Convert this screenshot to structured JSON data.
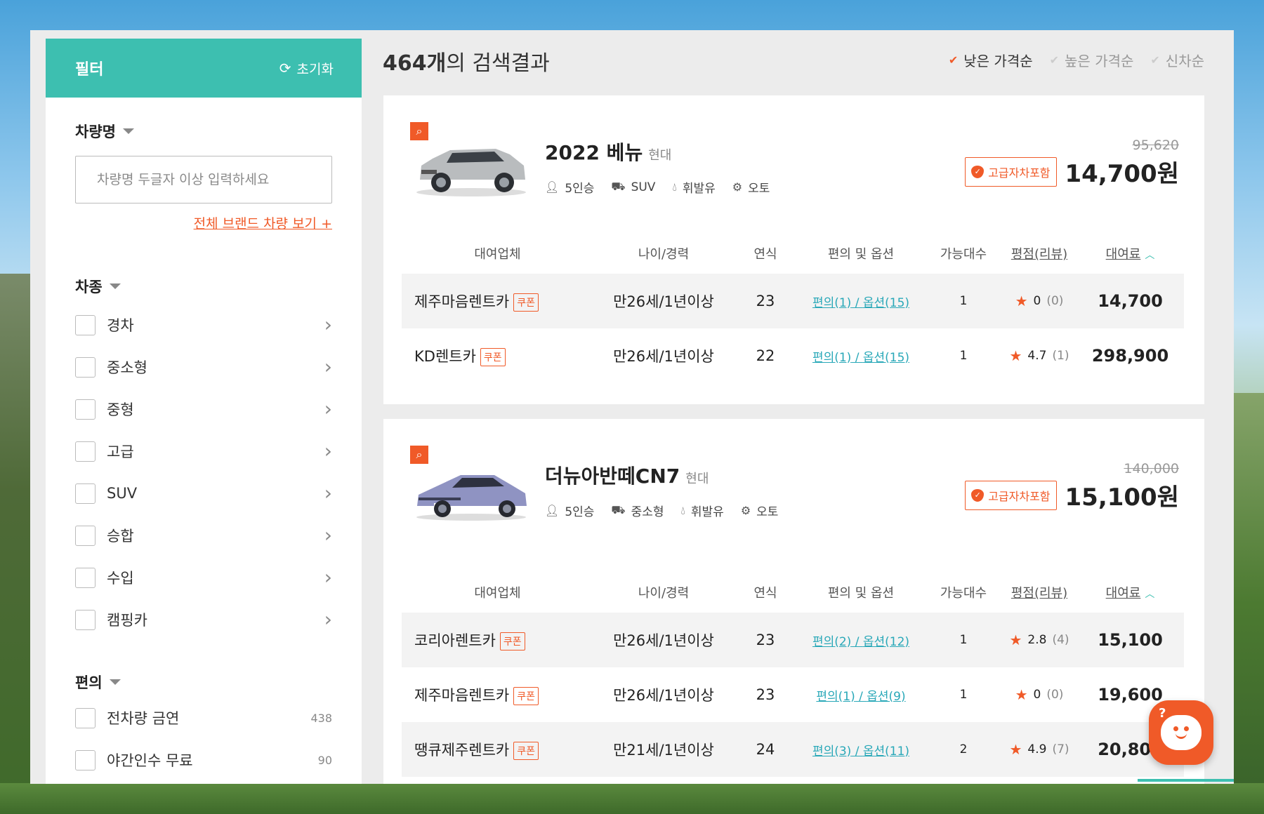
{
  "filter": {
    "title": "필터",
    "reset_label": "초기화",
    "car_name_section": {
      "title": "차량명",
      "placeholder": "차량명 두글자 이상 입력하세요",
      "all_brands_link": "전체 브랜드 차량 보기 +"
    },
    "car_type_section": {
      "title": "차종",
      "items": [
        {
          "label": "경차"
        },
        {
          "label": "중소형"
        },
        {
          "label": "중형"
        },
        {
          "label": "고급"
        },
        {
          "label": "SUV"
        },
        {
          "label": "승합"
        },
        {
          "label": "수입"
        },
        {
          "label": "캠핑카"
        }
      ]
    },
    "convenience_section": {
      "title": "편의",
      "items": [
        {
          "label": "전차량 금연",
          "count": "438"
        },
        {
          "label": "야간인수 무료",
          "count": "90"
        }
      ]
    }
  },
  "results": {
    "count": "464개",
    "suffix": "의 검색결과",
    "sort_options": [
      {
        "label": "낮은 가격순",
        "active": true
      },
      {
        "label": "높은 가격순",
        "active": false
      },
      {
        "label": "신차순",
        "active": false
      }
    ]
  },
  "table_headers": {
    "company": "대여업체",
    "age": "나이/경력",
    "year": "연식",
    "options": "편의 및 옵션",
    "available": "가능대수",
    "rating": "평점(리뷰)",
    "price": "대여료"
  },
  "coupon_label": "쿠폰",
  "cars": [
    {
      "name": "2022 베뉴",
      "brand": "현대",
      "specs": {
        "seats": "5인승",
        "type": "SUV",
        "fuel": "휘발유",
        "transmission": "오토"
      },
      "premium_badge": "고급자차포함",
      "old_price": "95,620",
      "price": "14,700원",
      "body_color": "#b9bcbe",
      "rows": [
        {
          "company": "제주마음렌트카",
          "age": "만26세/1년이상",
          "year": "23",
          "conv": "편의(1)",
          "opt": "옵션(15)",
          "units": "1",
          "rating": "0",
          "reviews": "(0)",
          "price": "14,700"
        },
        {
          "company": "KD렌트카",
          "age": "만26세/1년이상",
          "year": "22",
          "conv": "편의(1)",
          "opt": "옵션(15)",
          "units": "1",
          "rating": "4.7",
          "reviews": "(1)",
          "price": "298,900"
        }
      ]
    },
    {
      "name": "더뉴아반떼CN7",
      "brand": "현대",
      "specs": {
        "seats": "5인승",
        "type": "중소형",
        "fuel": "휘발유",
        "transmission": "오토"
      },
      "premium_badge": "고급자차포함",
      "old_price": "140,000",
      "price": "15,100원",
      "body_color": "#8f93c2",
      "rows": [
        {
          "company": "코리아렌트카",
          "age": "만26세/1년이상",
          "year": "23",
          "conv": "편의(2)",
          "opt": "옵션(12)",
          "units": "1",
          "rating": "2.8",
          "reviews": "(4)",
          "price": "15,100"
        },
        {
          "company": "제주마음렌트카",
          "age": "만26세/1년이상",
          "year": "23",
          "conv": "편의(1)",
          "opt": "옵션(9)",
          "units": "1",
          "rating": "0",
          "reviews": "(0)",
          "price": "19,600"
        },
        {
          "company": "땡큐제주렌트카",
          "age": "만21세/1년이상",
          "year": "24",
          "conv": "편의(3)",
          "opt": "옵션(11)",
          "units": "2",
          "rating": "4.9",
          "reviews": "(7)",
          "price": "20,800"
        }
      ]
    }
  ],
  "colors": {
    "accent_teal": "#3dbfb0",
    "accent_orange": "#f05a28",
    "link_teal": "#29a8b8"
  }
}
